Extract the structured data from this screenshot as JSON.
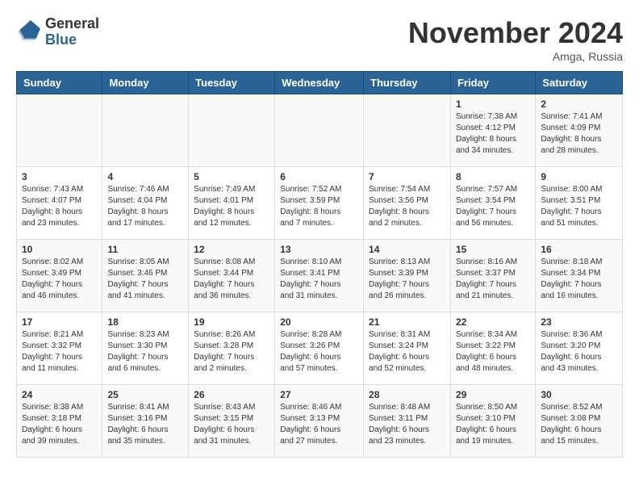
{
  "logo": {
    "general": "General",
    "blue": "Blue"
  },
  "title": "November 2024",
  "location": "Amga, Russia",
  "weekdays": [
    "Sunday",
    "Monday",
    "Tuesday",
    "Wednesday",
    "Thursday",
    "Friday",
    "Saturday"
  ],
  "weeks": [
    [
      {
        "day": "",
        "info": ""
      },
      {
        "day": "",
        "info": ""
      },
      {
        "day": "",
        "info": ""
      },
      {
        "day": "",
        "info": ""
      },
      {
        "day": "",
        "info": ""
      },
      {
        "day": "1",
        "info": "Sunrise: 7:38 AM\nSunset: 4:12 PM\nDaylight: 8 hours\nand 34 minutes."
      },
      {
        "day": "2",
        "info": "Sunrise: 7:41 AM\nSunset: 4:09 PM\nDaylight: 8 hours\nand 28 minutes."
      }
    ],
    [
      {
        "day": "3",
        "info": "Sunrise: 7:43 AM\nSunset: 4:07 PM\nDaylight: 8 hours\nand 23 minutes."
      },
      {
        "day": "4",
        "info": "Sunrise: 7:46 AM\nSunset: 4:04 PM\nDaylight: 8 hours\nand 17 minutes."
      },
      {
        "day": "5",
        "info": "Sunrise: 7:49 AM\nSunset: 4:01 PM\nDaylight: 8 hours\nand 12 minutes."
      },
      {
        "day": "6",
        "info": "Sunrise: 7:52 AM\nSunset: 3:59 PM\nDaylight: 8 hours\nand 7 minutes."
      },
      {
        "day": "7",
        "info": "Sunrise: 7:54 AM\nSunset: 3:56 PM\nDaylight: 8 hours\nand 2 minutes."
      },
      {
        "day": "8",
        "info": "Sunrise: 7:57 AM\nSunset: 3:54 PM\nDaylight: 7 hours\nand 56 minutes."
      },
      {
        "day": "9",
        "info": "Sunrise: 8:00 AM\nSunset: 3:51 PM\nDaylight: 7 hours\nand 51 minutes."
      }
    ],
    [
      {
        "day": "10",
        "info": "Sunrise: 8:02 AM\nSunset: 3:49 PM\nDaylight: 7 hours\nand 46 minutes."
      },
      {
        "day": "11",
        "info": "Sunrise: 8:05 AM\nSunset: 3:46 PM\nDaylight: 7 hours\nand 41 minutes."
      },
      {
        "day": "12",
        "info": "Sunrise: 8:08 AM\nSunset: 3:44 PM\nDaylight: 7 hours\nand 36 minutes."
      },
      {
        "day": "13",
        "info": "Sunrise: 8:10 AM\nSunset: 3:41 PM\nDaylight: 7 hours\nand 31 minutes."
      },
      {
        "day": "14",
        "info": "Sunrise: 8:13 AM\nSunset: 3:39 PM\nDaylight: 7 hours\nand 26 minutes."
      },
      {
        "day": "15",
        "info": "Sunrise: 8:16 AM\nSunset: 3:37 PM\nDaylight: 7 hours\nand 21 minutes."
      },
      {
        "day": "16",
        "info": "Sunrise: 8:18 AM\nSunset: 3:34 PM\nDaylight: 7 hours\nand 16 minutes."
      }
    ],
    [
      {
        "day": "17",
        "info": "Sunrise: 8:21 AM\nSunset: 3:32 PM\nDaylight: 7 hours\nand 11 minutes."
      },
      {
        "day": "18",
        "info": "Sunrise: 8:23 AM\nSunset: 3:30 PM\nDaylight: 7 hours\nand 6 minutes."
      },
      {
        "day": "19",
        "info": "Sunrise: 8:26 AM\nSunset: 3:28 PM\nDaylight: 7 hours\nand 2 minutes."
      },
      {
        "day": "20",
        "info": "Sunrise: 8:28 AM\nSunset: 3:26 PM\nDaylight: 6 hours\nand 57 minutes."
      },
      {
        "day": "21",
        "info": "Sunrise: 8:31 AM\nSunset: 3:24 PM\nDaylight: 6 hours\nand 52 minutes."
      },
      {
        "day": "22",
        "info": "Sunrise: 8:34 AM\nSunset: 3:22 PM\nDaylight: 6 hours\nand 48 minutes."
      },
      {
        "day": "23",
        "info": "Sunrise: 8:36 AM\nSunset: 3:20 PM\nDaylight: 6 hours\nand 43 minutes."
      }
    ],
    [
      {
        "day": "24",
        "info": "Sunrise: 8:38 AM\nSunset: 3:18 PM\nDaylight: 6 hours\nand 39 minutes."
      },
      {
        "day": "25",
        "info": "Sunrise: 8:41 AM\nSunset: 3:16 PM\nDaylight: 6 hours\nand 35 minutes."
      },
      {
        "day": "26",
        "info": "Sunrise: 8:43 AM\nSunset: 3:15 PM\nDaylight: 6 hours\nand 31 minutes."
      },
      {
        "day": "27",
        "info": "Sunrise: 8:46 AM\nSunset: 3:13 PM\nDaylight: 6 hours\nand 27 minutes."
      },
      {
        "day": "28",
        "info": "Sunrise: 8:48 AM\nSunset: 3:11 PM\nDaylight: 6 hours\nand 23 minutes."
      },
      {
        "day": "29",
        "info": "Sunrise: 8:50 AM\nSunset: 3:10 PM\nDaylight: 6 hours\nand 19 minutes."
      },
      {
        "day": "30",
        "info": "Sunrise: 8:52 AM\nSunset: 3:08 PM\nDaylight: 6 hours\nand 15 minutes."
      }
    ]
  ]
}
